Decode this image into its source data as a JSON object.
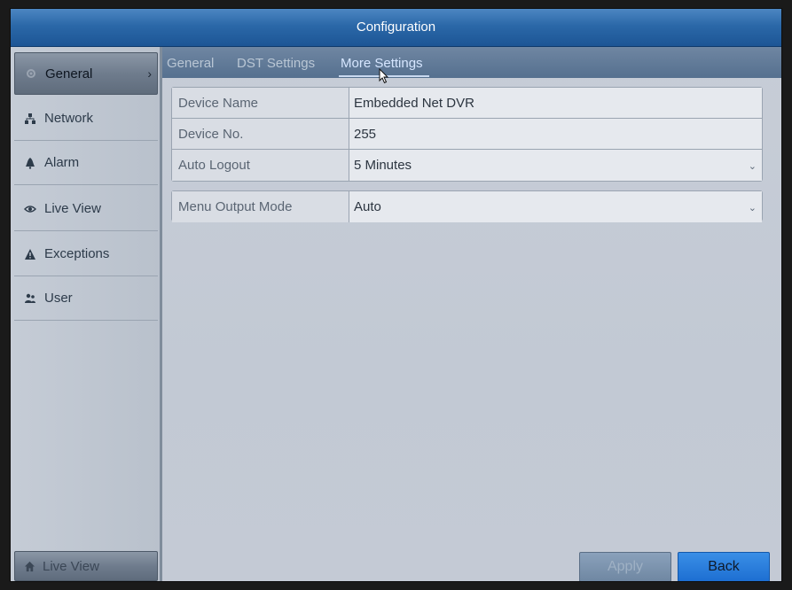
{
  "window": {
    "title": "Configuration"
  },
  "sidebar": {
    "items": [
      {
        "label": "General",
        "icon": "gear-icon",
        "active": true
      },
      {
        "label": "Network",
        "icon": "network-icon",
        "active": false
      },
      {
        "label": "Alarm",
        "icon": "alarm-icon",
        "active": false
      },
      {
        "label": "Live View",
        "icon": "eye-icon",
        "active": false
      },
      {
        "label": "Exceptions",
        "icon": "warning-icon",
        "active": false
      },
      {
        "label": "User",
        "icon": "users-icon",
        "active": false
      }
    ],
    "bottom": {
      "label": "Live View",
      "icon": "home-icon"
    }
  },
  "tabs": [
    {
      "label": "General",
      "active": false
    },
    {
      "label": "DST Settings",
      "active": false
    },
    {
      "label": "More Settings",
      "active": true
    }
  ],
  "form": {
    "device_name": {
      "label": "Device Name",
      "value": "Embedded Net DVR"
    },
    "device_no": {
      "label": "Device No.",
      "value": "255"
    },
    "auto_logout": {
      "label": "Auto Logout",
      "value": "5 Minutes"
    },
    "menu_output_mode": {
      "label": "Menu Output Mode",
      "value": "Auto"
    }
  },
  "buttons": {
    "apply": "Apply",
    "back": "Back"
  },
  "colors": {
    "title_bar": "#2b68a8",
    "back_button": "#1d6fd2",
    "active_tab": "#d6e6ff"
  }
}
